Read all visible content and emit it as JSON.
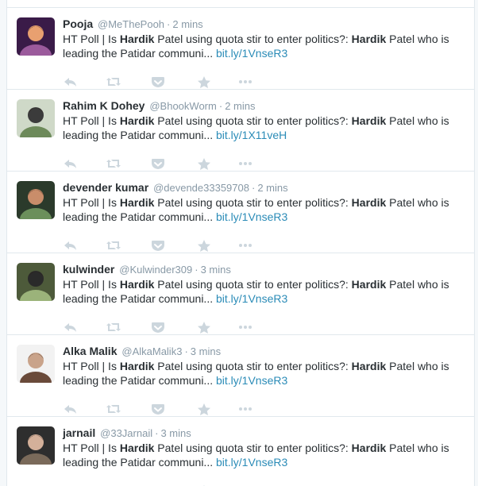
{
  "tweets": [
    {
      "name": "Pooja",
      "handle": "@MeThePooh",
      "sep": "·",
      "time": "2 mins",
      "text_parts": [
        "HT Poll | Is ",
        "Hardik",
        " Patel using quota stir to enter politics?: ",
        "Hardik",
        " Patel who is leading the Patidar communi... "
      ],
      "link": "bit.ly/1VnseR3",
      "avatar_icon": "avatar-image"
    },
    {
      "name": "Rahim K Dohey",
      "handle": "@BhookWorm",
      "sep": "·",
      "time": "2 mins",
      "text_parts": [
        "HT Poll | Is ",
        "Hardik",
        " Patel using quota stir to enter politics?: ",
        "Hardik",
        " Patel who is leading the Patidar communi... "
      ],
      "link": "bit.ly/1X11veH",
      "avatar_icon": "avatar-image"
    },
    {
      "name": "devender kumar",
      "handle": "@devende33359708",
      "sep": "·",
      "time": "2 mins",
      "text_parts": [
        "HT Poll | Is ",
        "Hardik",
        " Patel using quota stir to enter politics?: ",
        "Hardik",
        " Patel who is leading the Patidar communi... "
      ],
      "link": "bit.ly/1VnseR3",
      "avatar_icon": "avatar-image"
    },
    {
      "name": "kulwinder",
      "handle": "@Kulwinder309",
      "sep": "·",
      "time": "3 mins",
      "text_parts": [
        "HT Poll | Is ",
        "Hardik",
        " Patel using quota stir to enter politics?: ",
        "Hardik",
        " Patel who is leading the Patidar communi... "
      ],
      "link": "bit.ly/1VnseR3",
      "avatar_icon": "avatar-image"
    },
    {
      "name": "Alka Malik",
      "handle": "@AlkaMalik3",
      "sep": "·",
      "time": "3 mins",
      "text_parts": [
        "HT Poll | Is ",
        "Hardik",
        " Patel using quota stir to enter politics?: ",
        "Hardik",
        " Patel who is leading the Patidar communi... "
      ],
      "link": "bit.ly/1VnseR3",
      "avatar_icon": "avatar-image"
    },
    {
      "name": "jarnail",
      "handle": "@33Jarnail",
      "sep": "·",
      "time": "3 mins",
      "text_parts": [
        "HT Poll | Is ",
        "Hardik",
        " Patel using quota stir to enter politics?: ",
        "Hardik",
        " Patel who is leading the Patidar communi... "
      ],
      "link": "bit.ly/1VnseR3",
      "avatar_icon": "avatar-image"
    }
  ],
  "actions": [
    {
      "name": "reply-icon"
    },
    {
      "name": "retweet-icon"
    },
    {
      "name": "pocket-icon"
    },
    {
      "name": "favorite-star-icon"
    },
    {
      "name": "more-icon"
    }
  ],
  "colors": {
    "name": "#292f33",
    "meta": "#8899a6",
    "link": "#2a8bb7",
    "action_icon": "#ccd6dd",
    "divider": "#e1e8ed"
  }
}
